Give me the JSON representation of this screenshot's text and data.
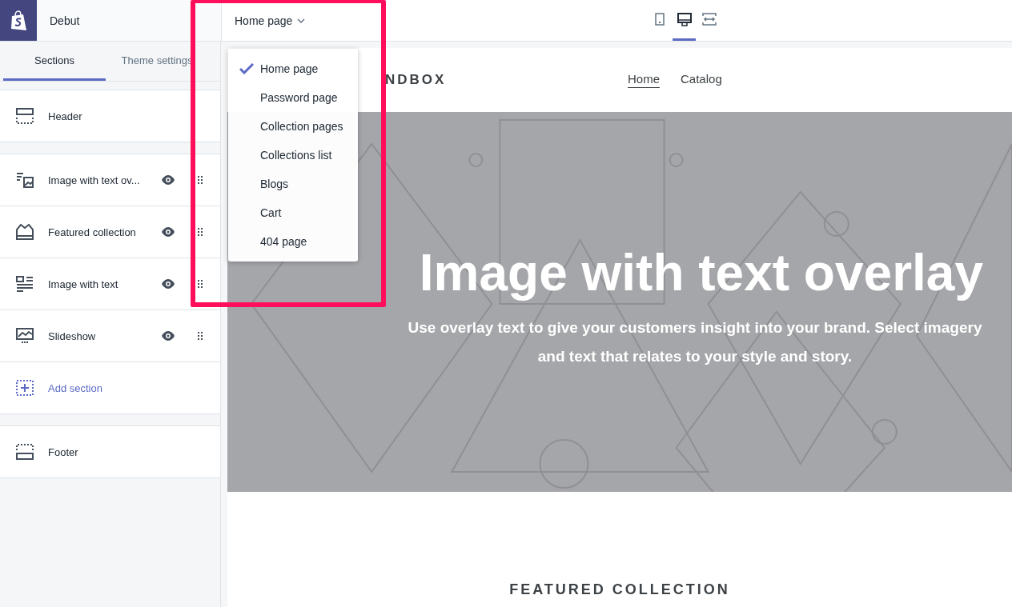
{
  "theme": {
    "name": "Debut"
  },
  "page_selector": {
    "label": "Home page"
  },
  "devices": [
    {
      "kind": "mobile",
      "selected": false
    },
    {
      "kind": "desktop",
      "selected": true
    },
    {
      "kind": "fullscreen",
      "selected": false
    }
  ],
  "sidebar": {
    "tabs": [
      {
        "label": "Sections",
        "selected": true
      },
      {
        "label": "Theme settings",
        "selected": false
      }
    ],
    "header_section": {
      "kind": "header",
      "label": "Header"
    },
    "sections": [
      {
        "kind": "image-overlay",
        "label": "Image with text ov...",
        "visible": true
      },
      {
        "kind": "featured",
        "label": "Featured collection",
        "visible": true
      },
      {
        "kind": "image-text",
        "label": "Image with text",
        "visible": true
      },
      {
        "kind": "slideshow",
        "label": "Slideshow",
        "visible": true
      }
    ],
    "add_section": "Add section",
    "footer_section": {
      "kind": "footer",
      "label": "Footer"
    }
  },
  "page_menu": [
    {
      "label": "Home page",
      "selected": true
    },
    {
      "label": "Password page",
      "selected": false
    },
    {
      "label": "Collection pages",
      "selected": false
    },
    {
      "label": "Collections list",
      "selected": false
    },
    {
      "label": "Blogs",
      "selected": false
    },
    {
      "label": "Cart",
      "selected": false
    },
    {
      "label": "404 page",
      "selected": false
    }
  ],
  "preview": {
    "store_name": "NDBOX",
    "nav": [
      {
        "label": "Home",
        "selected": true
      },
      {
        "label": "Catalog",
        "selected": false
      }
    ],
    "hero": {
      "title": "Image with text overlay",
      "text": "Use overlay text to give your customers insight into your brand. Select imagery and text that relates to your style and story."
    },
    "featured_heading": "FEATURED COLLECTION"
  }
}
